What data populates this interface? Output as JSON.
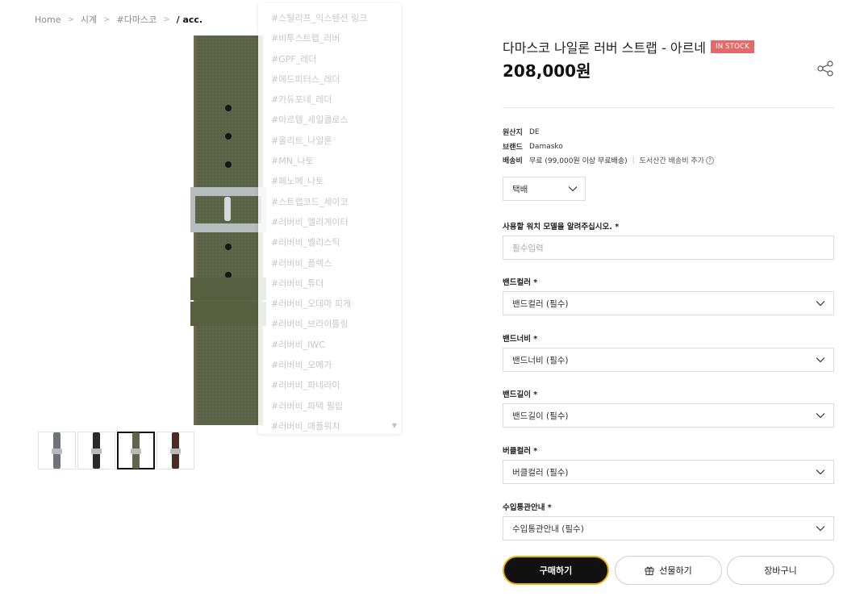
{
  "breadcrumb": {
    "items": [
      "Home",
      "시계",
      "#다마스코"
    ],
    "current": "/ acc."
  },
  "tags": [
    "#스틸리프_익스텐션 링크",
    "#비투스트랩_러버",
    "#GPF_레더",
    "#에드피터스_레더",
    "#카듀포네_레더",
    "#아르템_세일클로스",
    "#올리트_나일론",
    "#MN_나토",
    "#페노메_나토",
    "#스트랩코드_세이코",
    "#러버비_엘리게이터",
    "#러버비_벨리스틱",
    "#러버비_플렉스",
    "#러버비_튜더",
    "#러버비_오데마 피게",
    "#러버비_브라이틀링",
    "#러버비_IWC",
    "#러버비_오메가",
    "#러버비_파네라이",
    "#러버비_파텍 필립",
    "#러버비_애플워치"
  ],
  "tag_scroll_icon": "chevron-down-icon",
  "thumbnails": [
    {
      "name": "strap-gray",
      "color": "#6f7478"
    },
    {
      "name": "strap-black",
      "color": "#2a2a2a"
    },
    {
      "name": "strap-olive",
      "color": "#5e6649"
    },
    {
      "name": "strap-brown",
      "color": "#4a2c25"
    }
  ],
  "active_thumbnail": 2,
  "product": {
    "title": "다마스코 나일론 러버 스트랩 - 아르네",
    "badge": "IN STOCK",
    "price": "208,000원",
    "share_icon": "share-icon"
  },
  "meta": {
    "origin_label": "원산지",
    "origin_value": "DE",
    "brand_label": "브랜드",
    "brand_value": "Damasko",
    "shipping_label": "배송비",
    "shipping_value": "무료 (99,000원 이상 무료배송)",
    "shipping_extra": "도서산간 배송비 추가",
    "help_icon": "?"
  },
  "shipping_method": "택배",
  "options": {
    "watch_model_label": "사용할 워치 모델을 알려주십시오. *",
    "watch_model_placeholder": "필수입력",
    "band_color_label": "밴드컬러 *",
    "band_color_value": "밴드컬러 (필수)",
    "band_width_label": "밴드너비 *",
    "band_width_value": "밴드너비 (필수)",
    "band_length_label": "밴드길이 *",
    "band_length_value": "밴드길이 (필수)",
    "buckle_color_label": "버클컬러 *",
    "buckle_color_value": "버클컬러 (필수)",
    "customs_label": "수입통관안내 *",
    "customs_value": "수입통관안내 (필수)"
  },
  "buttons": {
    "buy": "구매하기",
    "gift": "선물하기",
    "cart": "장바구니"
  },
  "colors": {
    "badge": "#e26a6a",
    "buy_button": "#111111",
    "buy_border": "#e8b400",
    "strap": "#5e6649"
  }
}
